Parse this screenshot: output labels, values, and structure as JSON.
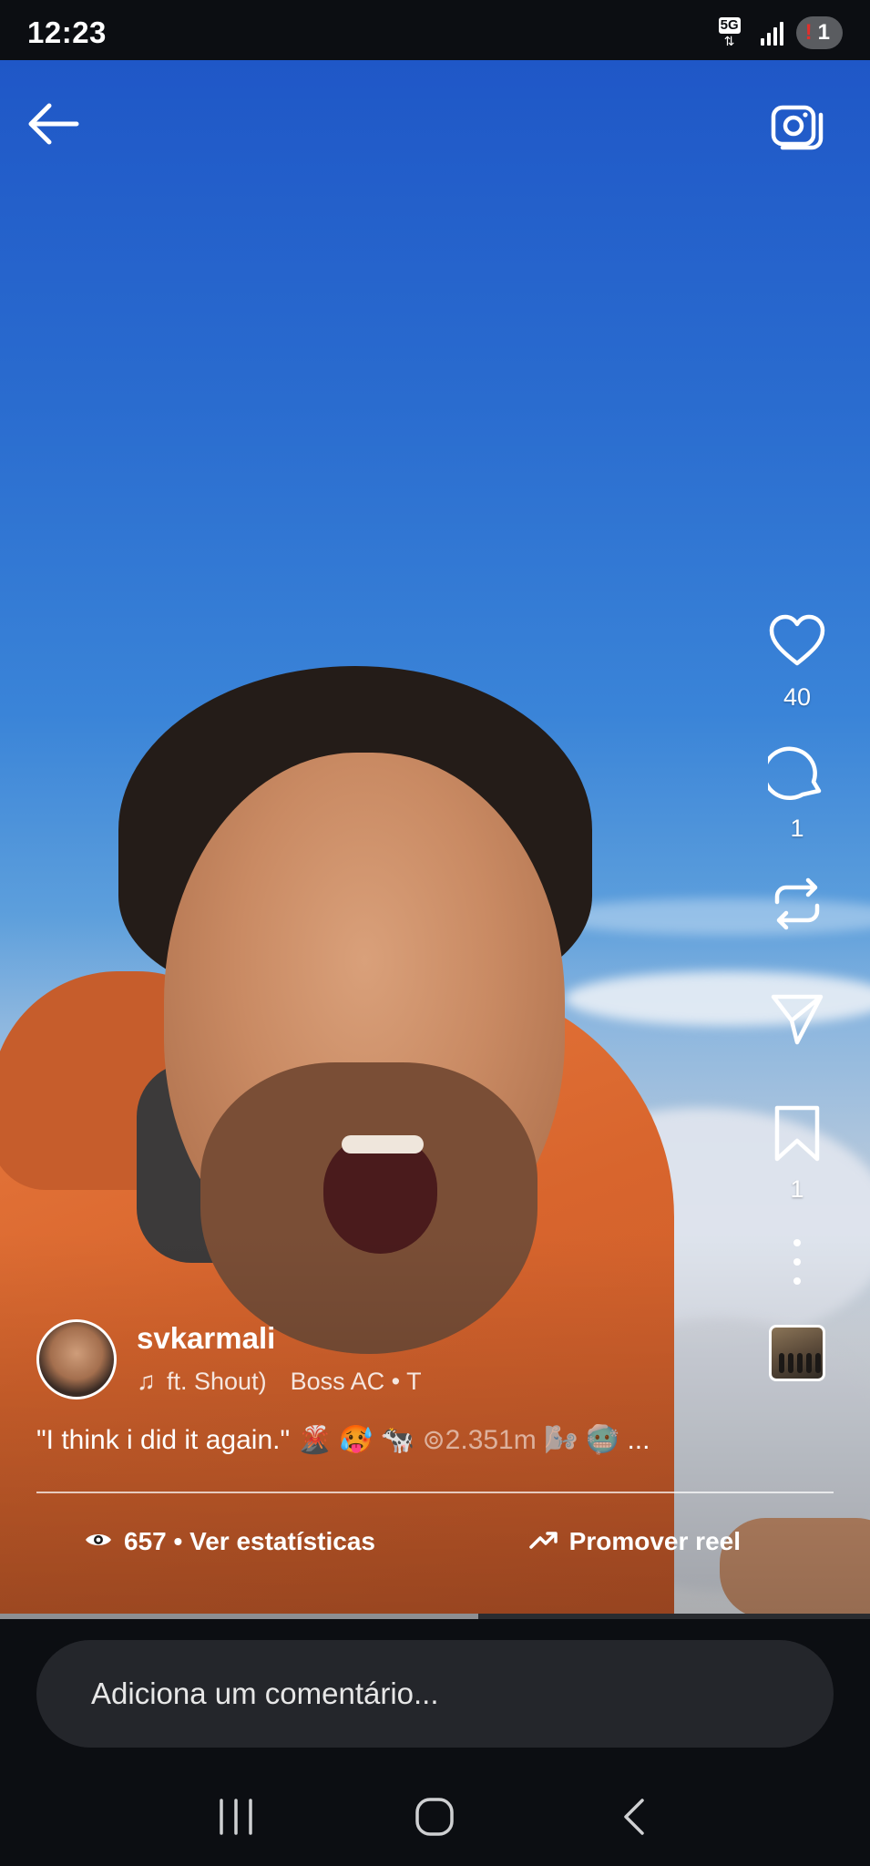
{
  "status_bar": {
    "time": "12:23",
    "network": "5G",
    "notification_count": "1"
  },
  "reel": {
    "likes": "40",
    "comments": "1",
    "saves": "1",
    "username": "svkarmali",
    "audio_left": "ft. Shout)",
    "audio_artist": "Boss AC • T",
    "caption_main": "\"I think i did it again.\" 🌋 🥵 🐄",
    "caption_faded": "⊚2.351m 🌬️ 🥶",
    "caption_more": "...",
    "views_text": "657 • Ver estatísticas",
    "promote_text": "Promover reel",
    "progress": 0.55
  },
  "comment_bar": {
    "placeholder": "Adiciona um comentário..."
  },
  "icons": {
    "back": "back-arrow-icon",
    "camera": "camera-icon",
    "like": "heart-icon",
    "comment": "comment-icon",
    "remix": "repost-icon",
    "share": "send-icon",
    "save": "bookmark-icon",
    "more": "more-vertical-icon",
    "views": "eye-icon",
    "promote": "trending-up-icon",
    "nav_recents": "recents-icon",
    "nav_home": "home-icon",
    "nav_back": "nav-back-icon"
  }
}
